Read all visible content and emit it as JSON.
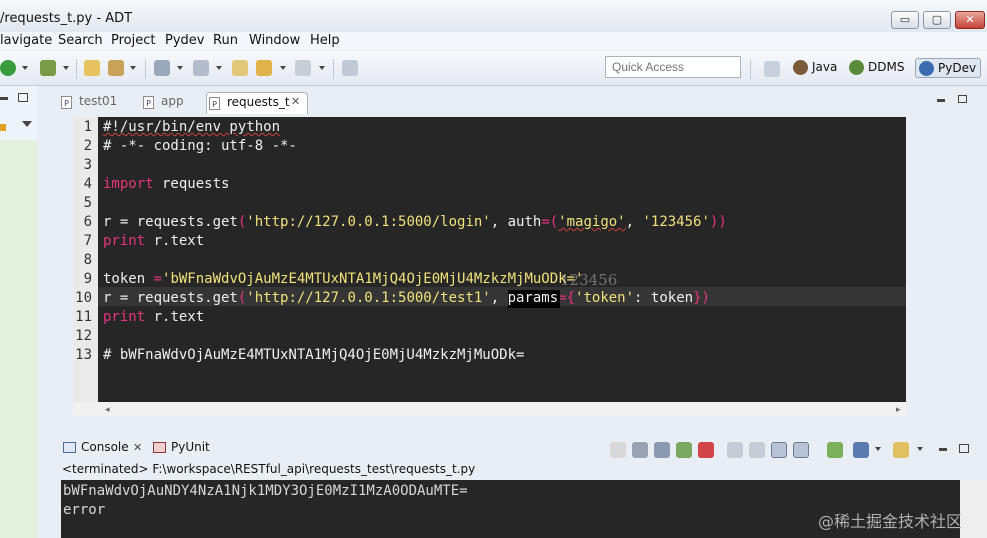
{
  "window": {
    "title": "/requests_t.py - ADT",
    "controls": {
      "minimize": "▭",
      "maximize": "▢",
      "close": "✕"
    }
  },
  "menu": [
    "lavigate",
    "Search",
    "Project",
    "Pydev",
    "Run",
    "Window",
    "Help"
  ],
  "toolbar": {
    "quick_access_placeholder": "Quick Access",
    "perspectives": [
      {
        "label": "Java",
        "icon": "java-perspective-icon"
      },
      {
        "label": "DDMS",
        "icon": "ddms-perspective-icon"
      },
      {
        "label": "PyDev",
        "icon": "pydev-perspective-icon",
        "active": true
      }
    ]
  },
  "editor": {
    "tabs": [
      {
        "label": "test01",
        "active": false
      },
      {
        "label": "app",
        "active": false
      },
      {
        "label": "requests_t",
        "active": true,
        "close": "✕"
      }
    ],
    "line_numbers": [
      "1",
      "2",
      "3",
      "4",
      "5",
      "6",
      "7",
      "8",
      "9",
      "10",
      "11",
      "12",
      "13"
    ],
    "lines": {
      "l1": "#!/usr/bin/env python",
      "l2": "# -*- coding: utf-8 -*-",
      "l4_kw": "import",
      "l4_rest": " requests",
      "l6_a": "r = requests.get",
      "l6_p1": "(",
      "l6_s1": "'http://127.0.0.1:5000/login'",
      "l6_b": ", auth",
      "l6_p2": "=(",
      "l6_s2": "'magigo'",
      "l6_c": ", ",
      "l6_s3": "'123456'",
      "l6_p3": "))",
      "l7_kw": "print",
      "l7_rest": " r.text",
      "l9_a": "token ",
      "l9_p": "=",
      "l9_s": "'bWFnaWdvOjAuMzE4MTUxNTA1MjQ4OjE0MjU4MzkzMjMuODk='",
      "l10_a": "r = requests.get",
      "l10_p1": "(",
      "l10_s1": "'http://127.0.0.1:5000/test1'",
      "l10_b": ", ",
      "l10_params": "params",
      "l10_p2": "={",
      "l10_s2": "'token'",
      "l10_c": ": token",
      "l10_p3": "})",
      "l11_kw": "print",
      "l11_rest": " r.text",
      "l13": "# bWFnaWdvOjAuMzE4MTUxNTA1MjQ4OjE0MjU4MzkzMjMuODk="
    },
    "overlay_text": "123456"
  },
  "console": {
    "tabs": [
      {
        "label": "Console",
        "close": "✕"
      },
      {
        "label": "PyUnit"
      }
    ],
    "terminated_line": "<terminated> F:\\workspace\\RESTful_api\\requests_test\\requests_t.py",
    "output": [
      "bWFnaWdvOjAuNDY4NzA1Njk1MDY3OjE0MzI1MzA0ODAuMTE=",
      "error"
    ]
  },
  "watermark": "@稀土掘金技术社区",
  "colors": {
    "editor_bg": "#262626",
    "keyword": "#e7347a",
    "string": "#f0e27a",
    "text": "#f0f0f0"
  }
}
